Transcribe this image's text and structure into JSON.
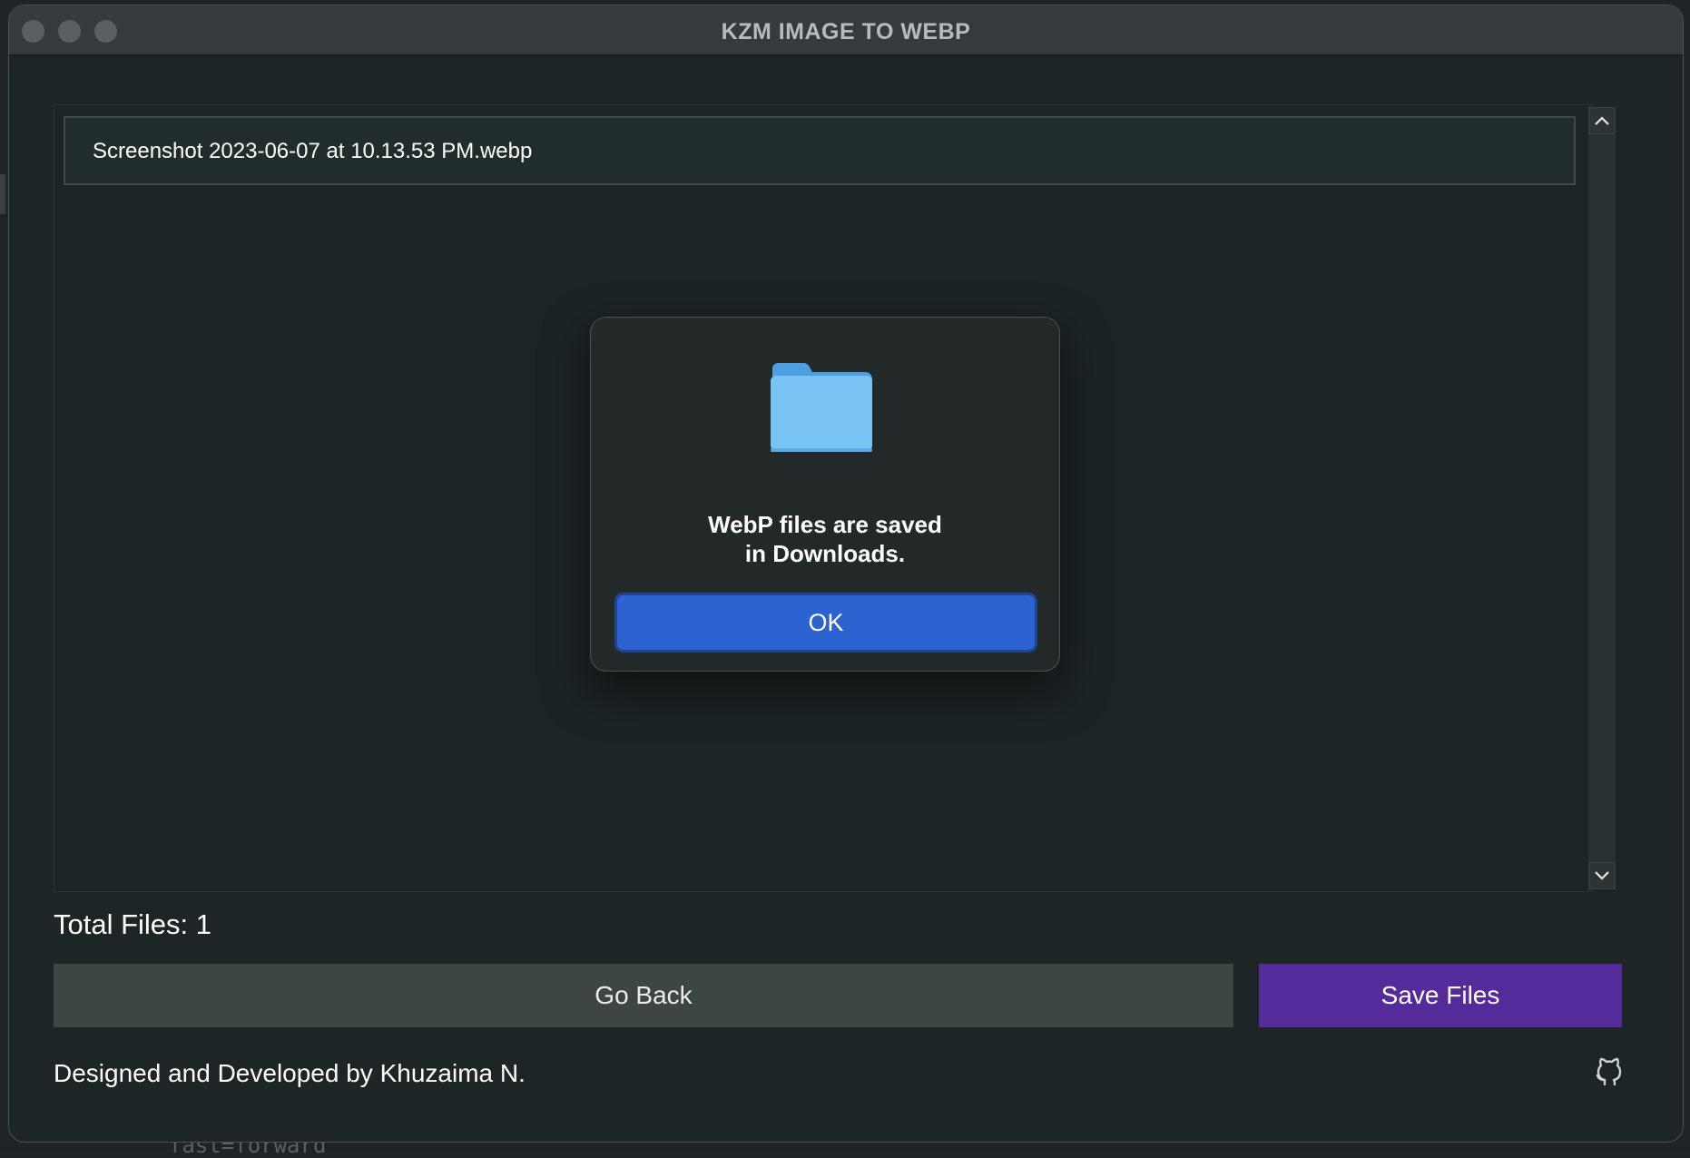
{
  "window": {
    "title": "KZM IMAGE TO WEBP"
  },
  "file_list": {
    "items": [
      {
        "name": "Screenshot 2023-06-07 at 10.13.53 PM.webp"
      }
    ]
  },
  "footer": {
    "total_files_label": "Total Files: 1",
    "go_back_label": "Go Back",
    "save_files_label": "Save Files",
    "credits": "Designed and Developed by Khuzaima N."
  },
  "dialog": {
    "message_line1": "WebP files are saved",
    "message_line2": "in Downloads.",
    "ok_label": "OK",
    "icon": "folder-icon"
  },
  "background": {
    "code_snippet": "fast=forward"
  },
  "colors": {
    "save_button": "#552a9a",
    "ok_button": "#2d62d1",
    "folder": "#78c3f3"
  }
}
